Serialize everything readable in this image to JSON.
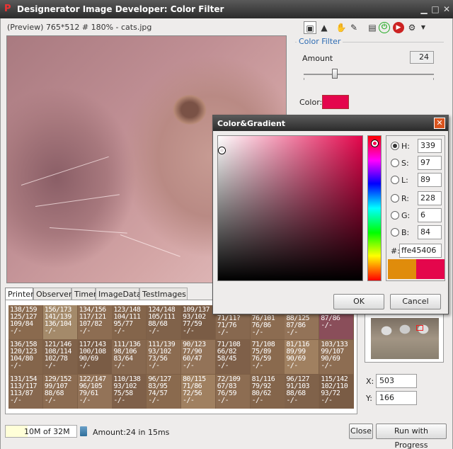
{
  "window": {
    "title": "Designerator Image Developer: Color Filter",
    "app_icon": "designerator-icon"
  },
  "preview": {
    "label": "(Preview) 765*512 # 180% - cats.jpg"
  },
  "toolbar": {
    "icons": [
      "image-icon",
      "histogram-icon",
      "hand-icon",
      "eyedropper-icon",
      "new-file-icon",
      "power-icon",
      "record-icon",
      "tools-icon",
      "dropdown-icon"
    ]
  },
  "filter": {
    "title": "Color Filter",
    "amount_label": "Amount",
    "amount_value": "24",
    "amount_level": 0.24,
    "color_label": "Color:",
    "color": "#e4064c"
  },
  "tabs": [
    "Printer",
    "Observer",
    "Timer",
    "ImageData",
    "TestImages"
  ],
  "pixel_grid": {
    "cells": [
      "138/159\n125/127\n109/84\n-/-",
      "156/173\n141/139\n136/104\n-/-",
      "134/156\n117/121\n107/82\n-/-",
      "123/148\n104/111\n95/77\n-/-",
      "124/148\n105/111\n88/68\n-/-",
      "109/137\n93/102\n77/59\n-/-",
      "",
      "",
      "",
      "",
      "136/158\n120/123\n104/80\n-/-",
      "121/146\n108/114\n102/78\n-/-",
      "117/143\n100/108\n90/69\n-/-",
      "111/136\n98/106\n83/64\n-/-",
      "111/139\n93/102\n73/56\n-/-",
      "90/123\n77/90\n60/47\n-/-",
      "71/108\n66/82\n58/45\n-/-",
      "71/108\n75/89\n76/59\n-/-",
      "81/116\n89/99\n90/69\n-/-",
      "103/133\n99/107\n90/69\n-/-",
      "131/154\n113/117\n113/87\n-/-",
      "129/152\n99/107\n88/68\n-/-",
      "122/147\n96/105\n79/61\n-/-",
      "110/138\n93/102\n75/58\n-/-",
      "96/127\n83/95\n74/57\n-/-",
      "80/115\n71/86\n72/56\n-/-",
      "72/109\n67/83\n76/59\n-/-",
      "81/116\n79/92\n80/62\n-/-",
      "96/127\n91/103\n88/68\n-/-",
      "115/142\n102/110\n93/72\n-/-"
    ],
    "row4_partial": [
      "71/11?\n71/76\n-/-",
      "76/101\n76/86\n-/-",
      "88/125\n87/86\n-/-",
      "87/86\n-/-"
    ]
  },
  "navigator": {
    "x_label": "X:",
    "x_value": "503",
    "y_label": "Y:",
    "y_value": "166"
  },
  "status": {
    "memory": "10M of 32M",
    "memory_fraction": 0.31,
    "message": "Amount:24  in 15ms",
    "close_label": "Close",
    "run_label": "Run with Progress"
  },
  "dialog": {
    "title": "Color&Gradient",
    "fields": [
      {
        "label": "H:",
        "value": "339",
        "selected": true
      },
      {
        "label": "S:",
        "value": "97",
        "selected": false
      },
      {
        "label": "L:",
        "value": "89",
        "selected": false
      },
      {
        "label": "R:",
        "value": "228",
        "selected": false
      },
      {
        "label": "G:",
        "value": "6",
        "selected": false
      },
      {
        "label": "B:",
        "value": "84",
        "selected": false
      }
    ],
    "hex_label": "#:",
    "hex_value": "ffe45406",
    "old_color": "#e08c0b",
    "new_color": "#e4064c",
    "ok_label": "OK",
    "cancel_label": "Cancel"
  }
}
